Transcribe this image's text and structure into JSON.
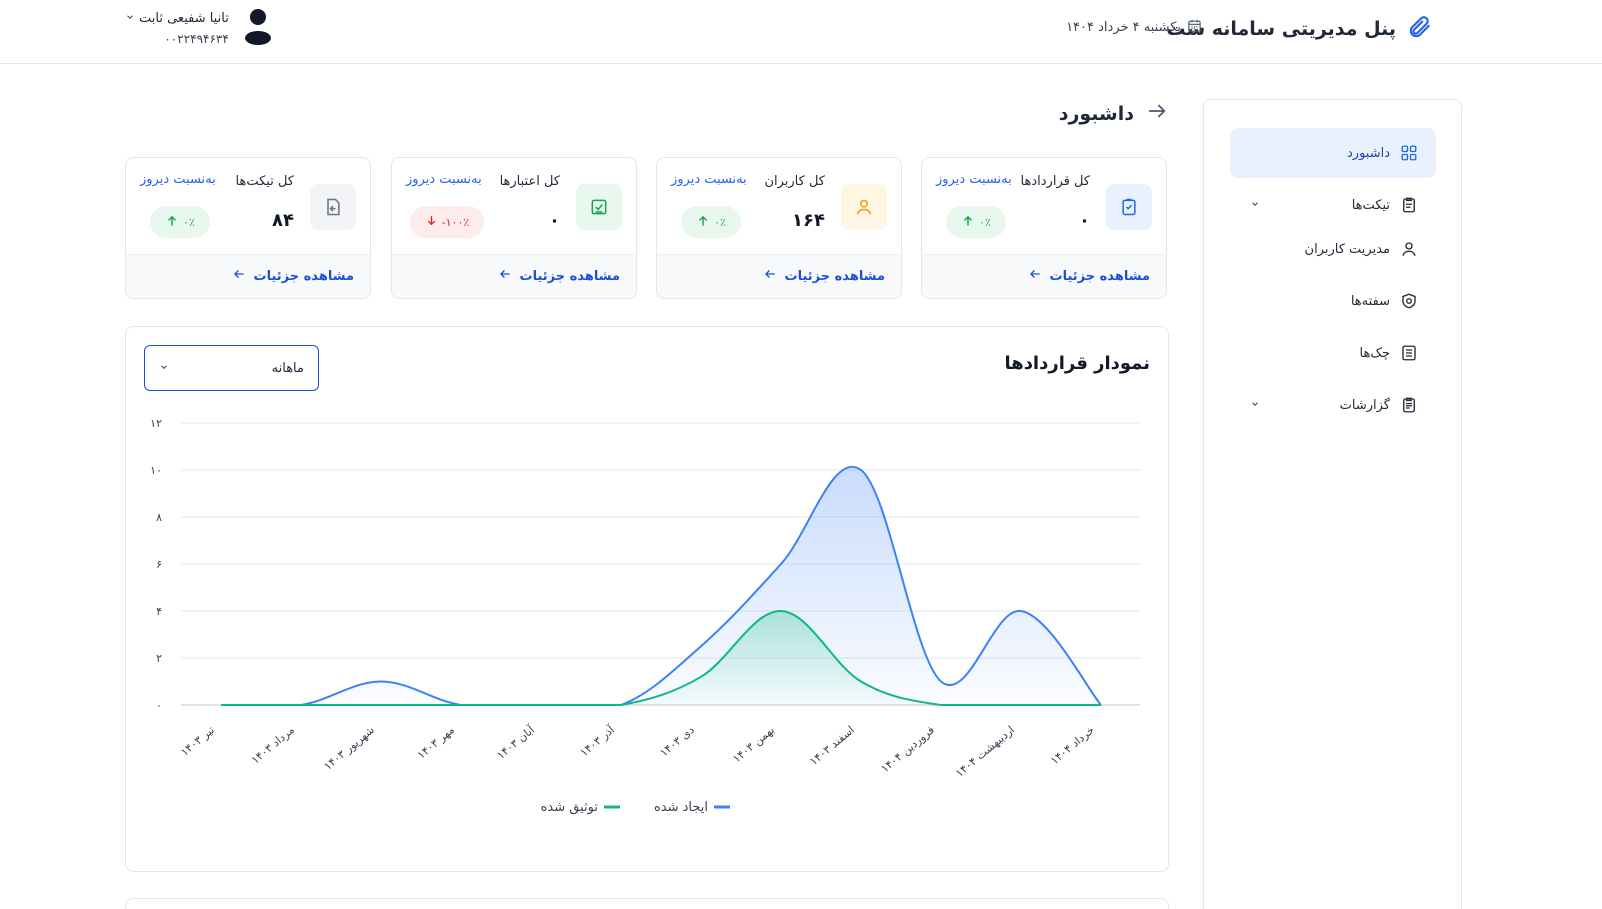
{
  "header": {
    "title": "پنل مدیریتی سامانه ست",
    "date": "یکشنبه ۴ خرداد ۱۴۰۴",
    "user_name": "تانیا شفیعی ثابت",
    "user_phone": "۰۰۲۲۴۹۴۶۳۴"
  },
  "sidebar": {
    "items": [
      {
        "label": "داشبورد",
        "icon": "grid-icon"
      },
      {
        "label": "تیکت‌ها",
        "icon": "clipboard-icon"
      },
      {
        "label": "مدیریت کاربران",
        "icon": "user-icon"
      },
      {
        "label": "سفته‌ها",
        "icon": "shield-icon"
      },
      {
        "label": "چک‌ها",
        "icon": "list-icon"
      },
      {
        "label": "گزارشات",
        "icon": "report-icon"
      }
    ]
  },
  "page": {
    "title": "داشبورد"
  },
  "cards": [
    {
      "label": "کل قراردادها",
      "value": "۰",
      "change": "۰٪",
      "trend": "up",
      "compare": "به‌نسبت دیروز",
      "link": "مشاهده جزئیات",
      "accent": "#2563eb",
      "bg": "#e8f1fd"
    },
    {
      "label": "کل کاربران",
      "value": "۱۶۴",
      "change": "۰٪",
      "trend": "up",
      "compare": "به‌نسبت دیروز",
      "link": "مشاهده جزئیات",
      "accent": "#f59e0b",
      "bg": "#fef6e4"
    },
    {
      "label": "کل اعتبارها",
      "value": "۰",
      "change": "-۱۰۰٪",
      "trend": "down",
      "compare": "به‌نسبت دیروز",
      "link": "مشاهده جزئیات",
      "accent": "#16a34a",
      "bg": "#e8f8ef"
    },
    {
      "label": "کل تیکت‌ها",
      "value": "۸۴",
      "change": "۰٪",
      "trend": "up",
      "compare": "به‌نسبت دیروز",
      "link": "مشاهده جزئیات",
      "accent": "#6b7280",
      "bg": "#f3f4f6"
    }
  ],
  "chart_section": {
    "title": "نمودار قراردادها",
    "period": "ماهانه"
  },
  "chart_data": {
    "type": "area",
    "categories": [
      "تیر ۱۴۰۳",
      "مرداد ۱۴۰۳",
      "شهریور ۱۴۰۳",
      "مهر ۱۴۰۳",
      "آبان ۱۴۰۳",
      "آذر ۱۴۰۳",
      "دی ۱۴۰۳",
      "بهمن ۱۴۰۳",
      "اسفند ۱۴۰۳",
      "فروردین ۱۴۰۴",
      "اردیبهشت ۱۴۰۴",
      "خرداد ۱۴۰۴"
    ],
    "series": [
      {
        "name": "ایجاد شده",
        "color": "#3b82f6",
        "values": [
          0,
          0,
          1,
          0,
          0,
          0,
          2.5,
          6,
          10,
          1,
          4,
          0
        ]
      },
      {
        "name": "توثیق شده",
        "color": "#10b981",
        "values": [
          0,
          0,
          0,
          0,
          0,
          0,
          1.2,
          4,
          1,
          0,
          0,
          0
        ]
      }
    ],
    "yticks": [
      "۰",
      "۲",
      "۴",
      "۶",
      "۸",
      "۱۰",
      "۱۲"
    ],
    "ylim": [
      0,
      12
    ],
    "legend": "bottom",
    "grid": true
  }
}
